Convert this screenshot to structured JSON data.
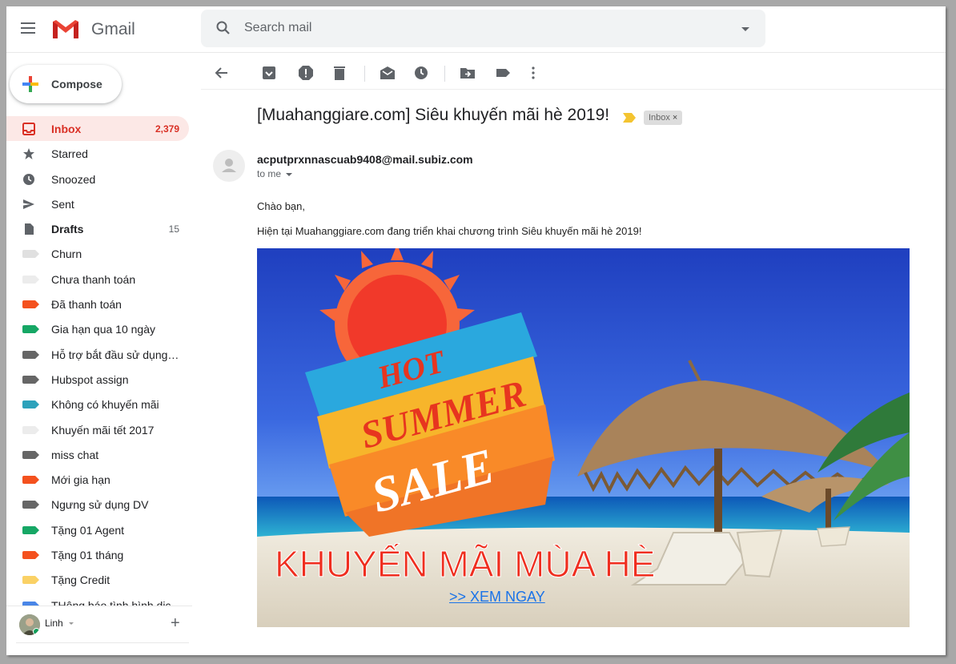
{
  "app": {
    "name": "Gmail"
  },
  "search": {
    "placeholder": "Search mail"
  },
  "compose": {
    "label": "Compose"
  },
  "nav": [
    {
      "label": "Inbox",
      "count": "2,379",
      "icon": "inbox-icon",
      "active": true
    },
    {
      "label": "Starred",
      "count": "",
      "icon": "star-icon"
    },
    {
      "label": "Snoozed",
      "count": "",
      "icon": "clock-icon"
    },
    {
      "label": "Sent",
      "count": "",
      "icon": "send-icon"
    },
    {
      "label": "Drafts",
      "count": "15",
      "icon": "draft-icon",
      "bold": true
    },
    {
      "label": "Churn",
      "count": "",
      "color": "#e0e0e0"
    },
    {
      "label": "Chưa thanh toán",
      "count": "",
      "color": "#ececec"
    },
    {
      "label": "Đã thanh toán",
      "count": "",
      "color": "#f4511e"
    },
    {
      "label": "Gia hạn qua 10 ngày",
      "count": "",
      "color": "#16a765"
    },
    {
      "label": "Hỗ trợ bắt đầu sử dụng ...",
      "count": "",
      "color": "#666666"
    },
    {
      "label": "Hubspot assign",
      "count": "",
      "color": "#666666"
    },
    {
      "label": "Không có khuyến mãi",
      "count": "",
      "color": "#2da2bb"
    },
    {
      "label": "Khuyến mãi tết 2017",
      "count": "",
      "color": "#ececec"
    },
    {
      "label": "miss chat",
      "count": "",
      "color": "#666666"
    },
    {
      "label": "Mới gia hạn",
      "count": "",
      "color": "#f4511e"
    },
    {
      "label": "Ngưng sử dụng DV",
      "count": "",
      "color": "#666666"
    },
    {
      "label": "Tặng 01 Agent",
      "count": "",
      "color": "#16a765"
    },
    {
      "label": "Tặng 01 tháng",
      "count": "",
      "color": "#f4511e"
    },
    {
      "label": "Tặng Credit",
      "count": "",
      "color": "#fad165"
    },
    {
      "label": "THông báo tình hình dịc",
      "count": "",
      "color": "#4986e7"
    }
  ],
  "hangouts": {
    "user": "Linh"
  },
  "message": {
    "subject": "[Muahanggiare.com] Siêu khuyến mãi hè 2019!",
    "label_chip": "Inbox",
    "label_chip_close": "×",
    "sender": "acputprxnnascuab9408@mail.subiz.com",
    "recipient": "to me",
    "greeting": "Chào bạn,",
    "body": "Hiện tại Muahanggiare.com đang triển khai chương trình Siêu khuyến mãi hè 2019!"
  },
  "banner": {
    "line1": "HOT",
    "line2": "SUMMER",
    "line3": "SALE",
    "headline": "KHUYẾN MÃI MÙA HÈ",
    "cta": ">> XEM NGAY"
  },
  "colors": {
    "accent_red": "#d93025",
    "active_bg": "#fce8e6"
  }
}
